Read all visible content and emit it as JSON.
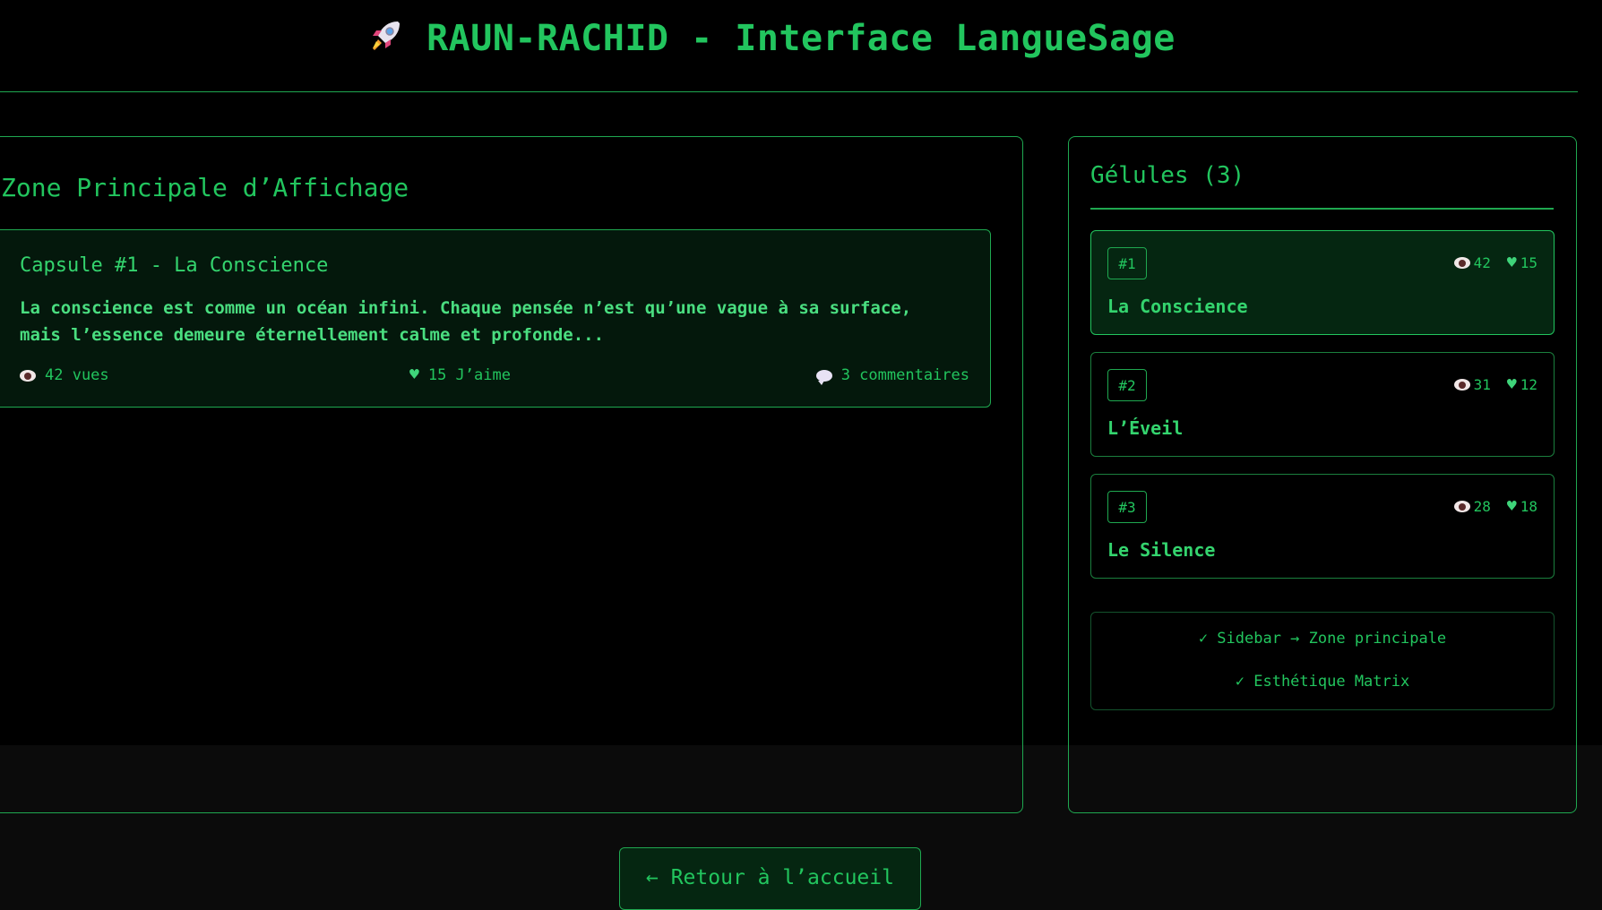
{
  "header": {
    "icon": "rocket-icon",
    "title": "RAUN-RACHID - Interface LangueSage"
  },
  "main": {
    "zone_title": "Zone Principale d’Affichage",
    "capsule": {
      "title": "Capsule #1 - La Conscience",
      "text": "La conscience est comme un océan infini. Chaque pensée n’est qu’une vague à sa surface, mais l’essence demeure éternellement calme et profonde...",
      "views": "42 vues",
      "likes": "15 J’aime",
      "comments": "3 commentaires"
    }
  },
  "sidebar": {
    "title": "Gélules (3)",
    "items": [
      {
        "badge": "#1",
        "name": "La Conscience",
        "views": "42",
        "likes": "15",
        "active": true
      },
      {
        "badge": "#2",
        "name": "L’Éveil",
        "views": "31",
        "likes": "12",
        "active": false
      },
      {
        "badge": "#3",
        "name": "Le Silence",
        "views": "28",
        "likes": "18",
        "active": false
      }
    ],
    "features": [
      "✓ Sidebar → Zone principale",
      "✓ Esthétique Matrix"
    ]
  },
  "footer": {
    "back_label": "← Retour à l’accueil"
  },
  "colors": {
    "accent": "#22c55e",
    "background": "#000000",
    "card_bg": "#04180c"
  }
}
